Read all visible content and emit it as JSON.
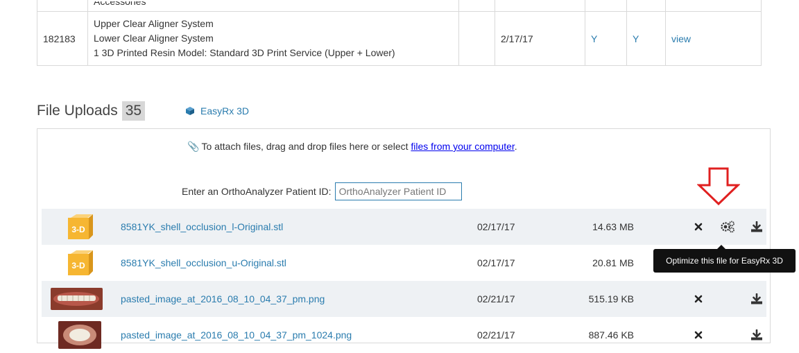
{
  "order_table": {
    "partial_row_text": "Accessories",
    "row": {
      "id": "182183",
      "items": [
        "Upper Clear Aligner System",
        "Lower Clear Aligner System",
        "1 3D Printed Resin Model: Standard 3D Print Service (Upper + Lower)"
      ],
      "date": "2/17/17",
      "flag_1": "Y",
      "flag_2": "Y",
      "view_label": "view"
    }
  },
  "uploads": {
    "title": "File Uploads",
    "count": "35",
    "easyrx_label": "EasyRx 3D",
    "drop_hint_prefix": "To attach files, drag and drop files here or select",
    "drop_hint_link": "files from your computer",
    "drop_hint_suffix": ".",
    "patient_label": "Enter an OrthoAnalyzer Patient ID:",
    "patient_placeholder": "OrthoAnalyzer Patient ID"
  },
  "files": [
    {
      "name": "8581YK_shell_occlusion_l-Original.stl",
      "date": "02/17/17",
      "size": "14.63 MB",
      "thumb": "3d-icon",
      "optimize": true
    },
    {
      "name": "8581YK_shell_occlusion_u-Original.stl",
      "date": "02/17/17",
      "size": "20.81 MB",
      "thumb": "3d-icon",
      "optimize": true
    },
    {
      "name": "pasted_image_at_2016_08_10_04_37_pm.png",
      "date": "02/21/17",
      "size": "515.19 KB",
      "thumb": "photo",
      "optimize": false
    },
    {
      "name": "pasted_image_at_2016_08_10_04_37_pm_1024.png",
      "date": "02/21/17",
      "size": "887.46 KB",
      "thumb": "photo",
      "optimize": false
    }
  ],
  "tooltip": "Optimize this file for EasyRx 3D",
  "colors": {
    "link": "#2a7cae",
    "arrow": "#e02020",
    "tooltip_bg": "#111111",
    "row_shade": "#eef1f4"
  }
}
